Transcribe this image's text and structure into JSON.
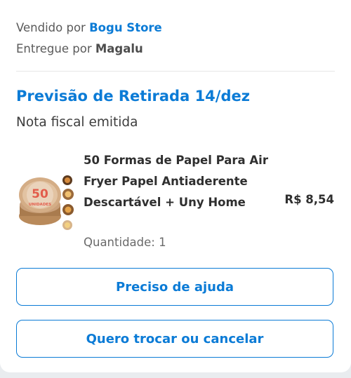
{
  "seller": {
    "label": "Vendido por",
    "name": "Bogu Store"
  },
  "delivery": {
    "label": "Entregue por",
    "name": "Magalu"
  },
  "pickup": {
    "title": "Previsão de Retirada 14/dez"
  },
  "invoice": {
    "status": "Nota fiscal emitida"
  },
  "product": {
    "title": "50 Formas de Papel Para Air Fryer Papel Antiaderente Descartável + Uny Home",
    "price": "R$ 8,54",
    "quantity": "Quantidade: 1",
    "image_text": {
      "number": "50",
      "word": "UNIDADES"
    }
  },
  "actions": {
    "help_label": "Preciso de ajuda",
    "exchange_label": "Quero trocar ou cancelar"
  },
  "colors": {
    "accent": "#0b7bd6",
    "text": "#404040",
    "background": "#e9ecef"
  }
}
